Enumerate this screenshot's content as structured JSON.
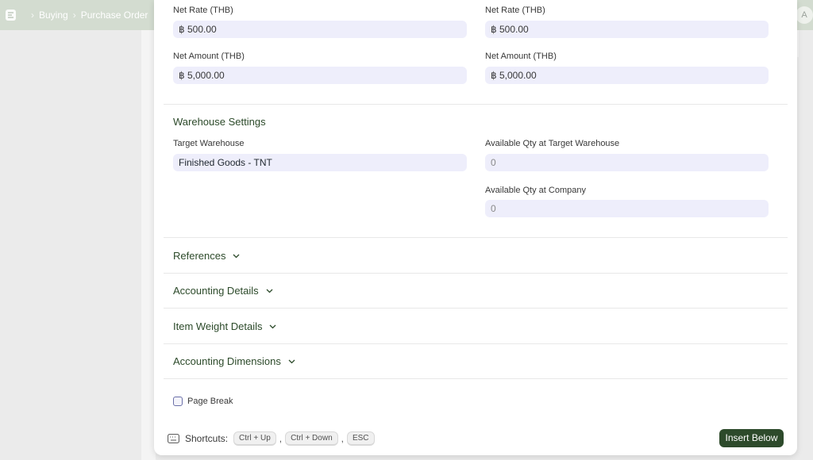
{
  "background": {
    "breadcrumb": [
      "Buying",
      "Purchase Order"
    ],
    "avatar_initial": "A",
    "separator": "›"
  },
  "dialog": {
    "pricing": {
      "net_rate_label": "Net Rate (THB)",
      "net_rate_value": "฿ 500.00",
      "net_rate_company_label": "Net Rate (THB)",
      "net_rate_company_value": "฿ 500.00",
      "net_amount_label": "Net Amount (THB)",
      "net_amount_value": "฿ 5,000.00",
      "net_amount_company_label": "Net Amount (THB)",
      "net_amount_company_value": "฿ 5,000.00"
    },
    "warehouse": {
      "section_title": "Warehouse Settings",
      "target_label": "Target Warehouse",
      "target_value": "Finished Goods - TNT",
      "available_target_label": "Available Qty at Target Warehouse",
      "available_target_value": "0",
      "available_company_label": "Available Qty at Company",
      "available_company_value": "0"
    },
    "sections": [
      {
        "label": "References"
      },
      {
        "label": "Accounting Details"
      },
      {
        "label": "Item Weight Details"
      },
      {
        "label": "Accounting Dimensions"
      }
    ],
    "page_break_label": "Page Break",
    "page_break_checked": false,
    "shortcuts": {
      "label": "Shortcuts:",
      "keys": [
        "Ctrl + Up",
        "Ctrl + Down",
        "ESC"
      ],
      "separator": ","
    },
    "insert_below_label": "Insert Below"
  },
  "colors": {
    "primary_button": "#2d4a2b",
    "input_bg": "#eeeefb",
    "section_title": "#2c4a2a"
  }
}
